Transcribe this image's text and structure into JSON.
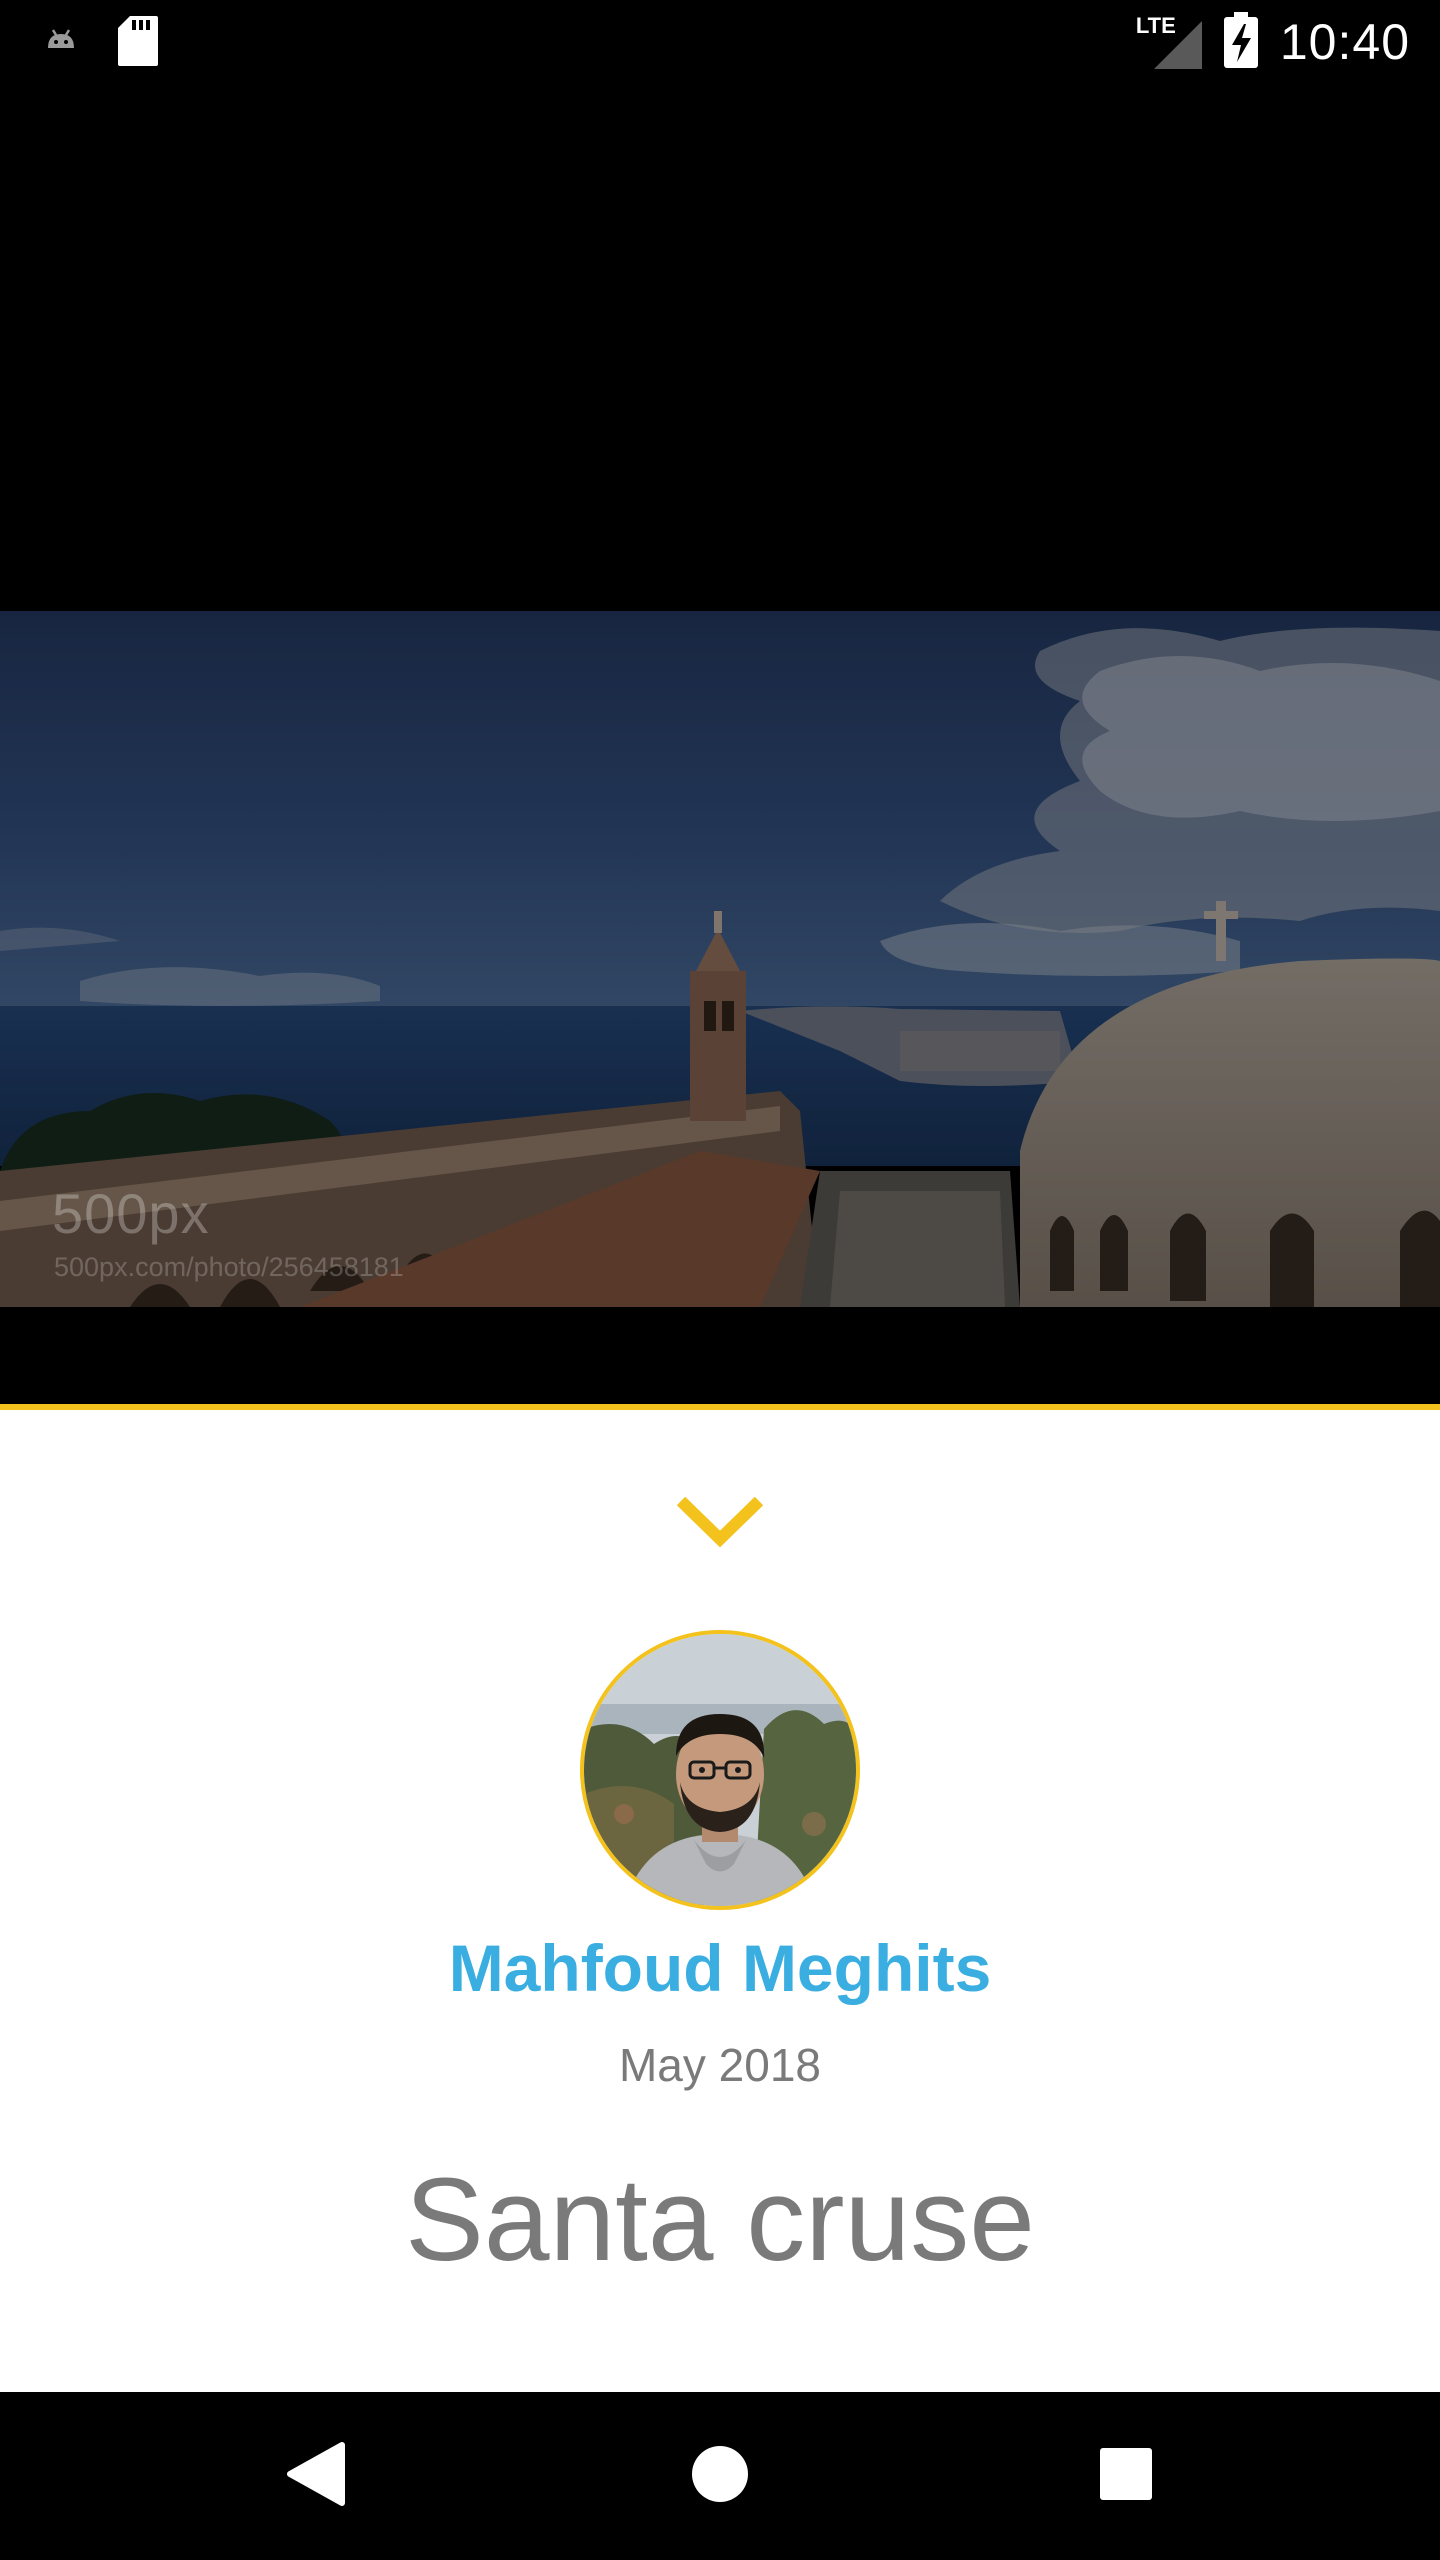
{
  "status_bar": {
    "time": "10:40",
    "network_label": "LTE",
    "icons": [
      "android-icon",
      "sd-card-icon",
      "signal-icon",
      "battery-charging-icon"
    ]
  },
  "photo": {
    "description_icon": "photo-landscape",
    "watermark_logo": "500px",
    "watermark_url": "500px.com/photo/256458181"
  },
  "info": {
    "collapse_icon": "chevron-down-icon",
    "author_name": "Mahfoud Meghits",
    "date": "May 2018",
    "title": "Santa cruse"
  },
  "nav_bar": {
    "icons": [
      "back-icon",
      "home-icon",
      "recents-icon"
    ]
  },
  "colors": {
    "accent": "#f4c21c",
    "author": "#3aaee0",
    "muted_text": "#7a7a7a",
    "panel_bg": "#ffffff",
    "bars_bg": "#000000"
  }
}
